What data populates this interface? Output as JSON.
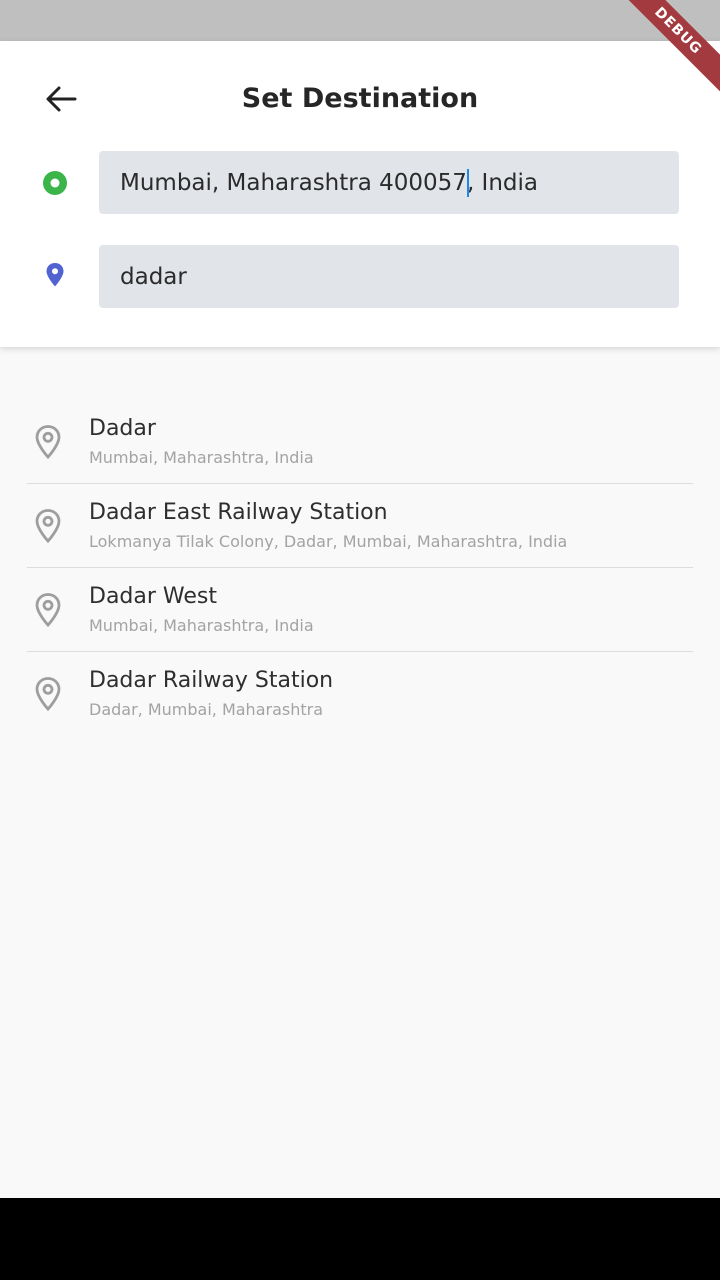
{
  "header": {
    "title": "Set Destination",
    "back_icon": "arrow-left-icon"
  },
  "origin": {
    "value": "Mumbai, Maharashtra 400057, India",
    "value_before_caret": "Mumbai, Maharashtra 400057",
    "value_after_caret": ", India",
    "icon": "origin-dot-icon",
    "color": "#3bb54a"
  },
  "destination": {
    "value": "dadar",
    "icon": "map-pin-icon",
    "color": "#5063d1"
  },
  "results": [
    {
      "name": "Dadar",
      "address": "Mumbai, Maharashtra, India"
    },
    {
      "name": "Dadar East Railway Station",
      "address": "Lokmanya Tilak Colony, Dadar, Mumbai, Maharashtra, India"
    },
    {
      "name": "Dadar West",
      "address": "Mumbai, Maharashtra, India"
    },
    {
      "name": "Dadar Railway Station",
      "address": "Dadar, Mumbai, Maharashtra"
    }
  ],
  "debug_banner": "DEBUG",
  "colors": {
    "header_bg": "#ffffff",
    "field_bg": "#e1e4e8",
    "page_bg": "#f9f9f9",
    "debug_banner": "#a33a3f"
  }
}
